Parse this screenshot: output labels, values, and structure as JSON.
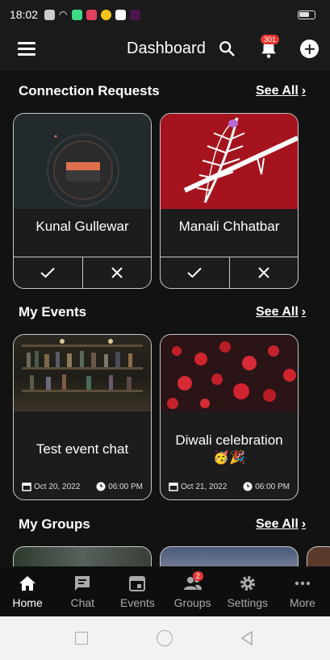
{
  "status": {
    "time": "18:02"
  },
  "appbar": {
    "title": "Dashboard",
    "notification_count": "301"
  },
  "connections": {
    "title": "Connection Requests",
    "see_all": "See All",
    "items": [
      {
        "name": "Kunal Gullewar"
      },
      {
        "name": "Manali Chhatbar"
      }
    ]
  },
  "events": {
    "title": "My Events",
    "see_all": "See All",
    "items": [
      {
        "name": "Test event chat",
        "date": "Oct 20, 2022",
        "time": "06:00 PM"
      },
      {
        "name": "Diwali celebration",
        "emoji": "🥳🎉",
        "date": "Oct 21, 2022",
        "time": "06:00 PM"
      }
    ]
  },
  "groups": {
    "title": "My Groups",
    "see_all": "See All"
  },
  "nav": {
    "items": [
      {
        "label": "Home"
      },
      {
        "label": "Chat"
      },
      {
        "label": "Events"
      },
      {
        "label": "Groups",
        "badge": "2"
      },
      {
        "label": "Settings"
      },
      {
        "label": "More"
      }
    ]
  },
  "colors": {
    "background": "#121212",
    "badge": "#e53935",
    "card_border": "#c8c8c8"
  }
}
